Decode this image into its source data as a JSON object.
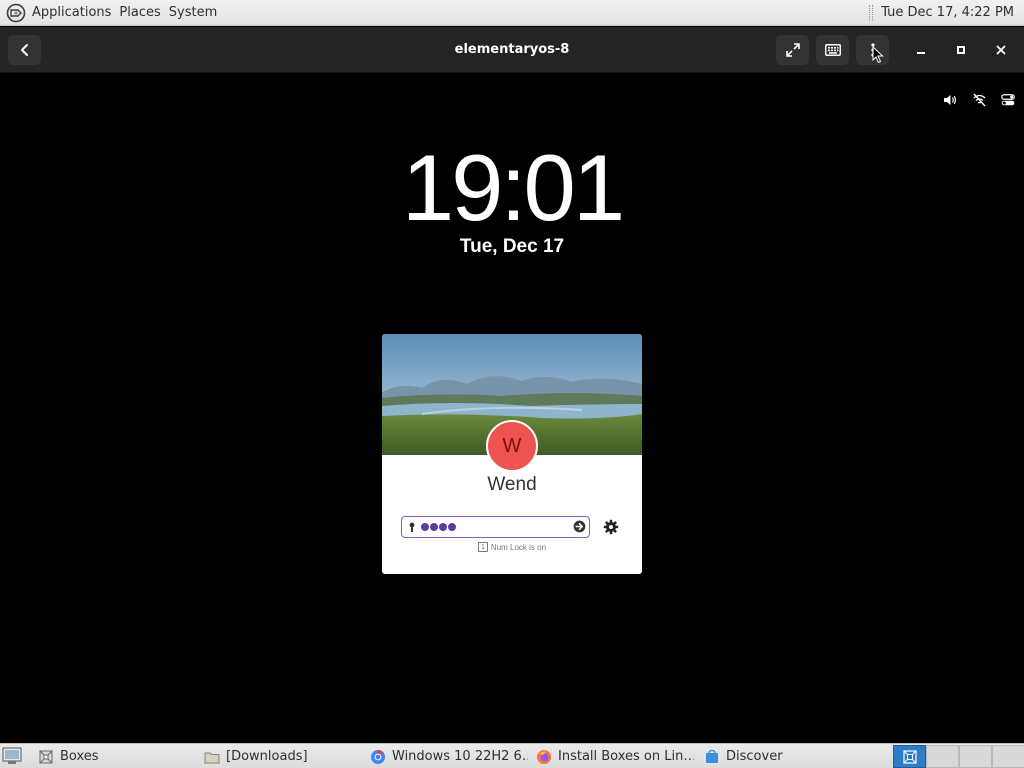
{
  "top_panel": {
    "menu": [
      "Applications",
      "Places",
      "System"
    ],
    "clock": "Tue Dec 17,  4:22 PM"
  },
  "headerbar": {
    "title": "elementaryos-8",
    "icons": {
      "back": "back-arrow-icon",
      "fullscreen": "fullscreen-icon",
      "keyboard": "keyboard-icon",
      "menu": "vertical-dots-menu-icon",
      "minimize": "minimize-icon",
      "maximize": "maximize-icon",
      "close": "close-icon"
    }
  },
  "guest": {
    "status_icons": [
      "volume-icon",
      "network-disconnected-icon",
      "toggle-settings-icon"
    ],
    "time": "19:01",
    "date": "Tue, Dec 17",
    "login": {
      "avatar_initial": "W",
      "avatar_color": "#ef5350",
      "user_name": "Wend",
      "password_length": 4,
      "numlock_hint": "Num Lock is on",
      "numlock_icon_glyph": "1",
      "field_accent": "#8a5cc0"
    }
  },
  "taskbar": {
    "tasks": [
      {
        "label": "Boxes",
        "active": true,
        "icon": "boxes-app-icon"
      },
      {
        "label": "[Downloads]",
        "active": false,
        "icon": "folder-icon"
      },
      {
        "label": "Windows 10 22H2 6…",
        "active": false,
        "icon": "chrome-icon"
      },
      {
        "label": "Install Boxes on Lin…",
        "active": false,
        "icon": "firefox-icon"
      },
      {
        "label": "Discover",
        "active": false,
        "icon": "discover-icon"
      }
    ],
    "workspaces": 4,
    "active_workspace": 1
  }
}
